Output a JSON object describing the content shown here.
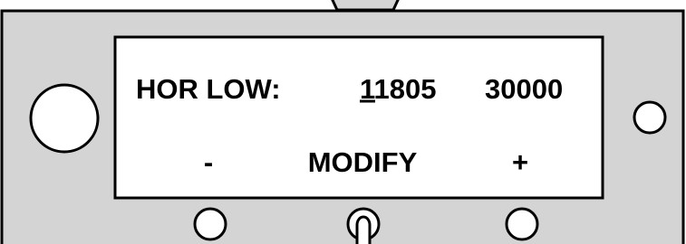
{
  "display": {
    "parameter_label": "HOR LOW:",
    "value_cursor_digit": "1",
    "value_rest": "1805",
    "limit_value": "30000"
  },
  "softkeys": {
    "left_label": "-",
    "center_label": "MODIFY",
    "right_label": "+"
  },
  "colors": {
    "panel": "#d4d4d4",
    "screen": "#ffffff",
    "outline": "#000000"
  }
}
